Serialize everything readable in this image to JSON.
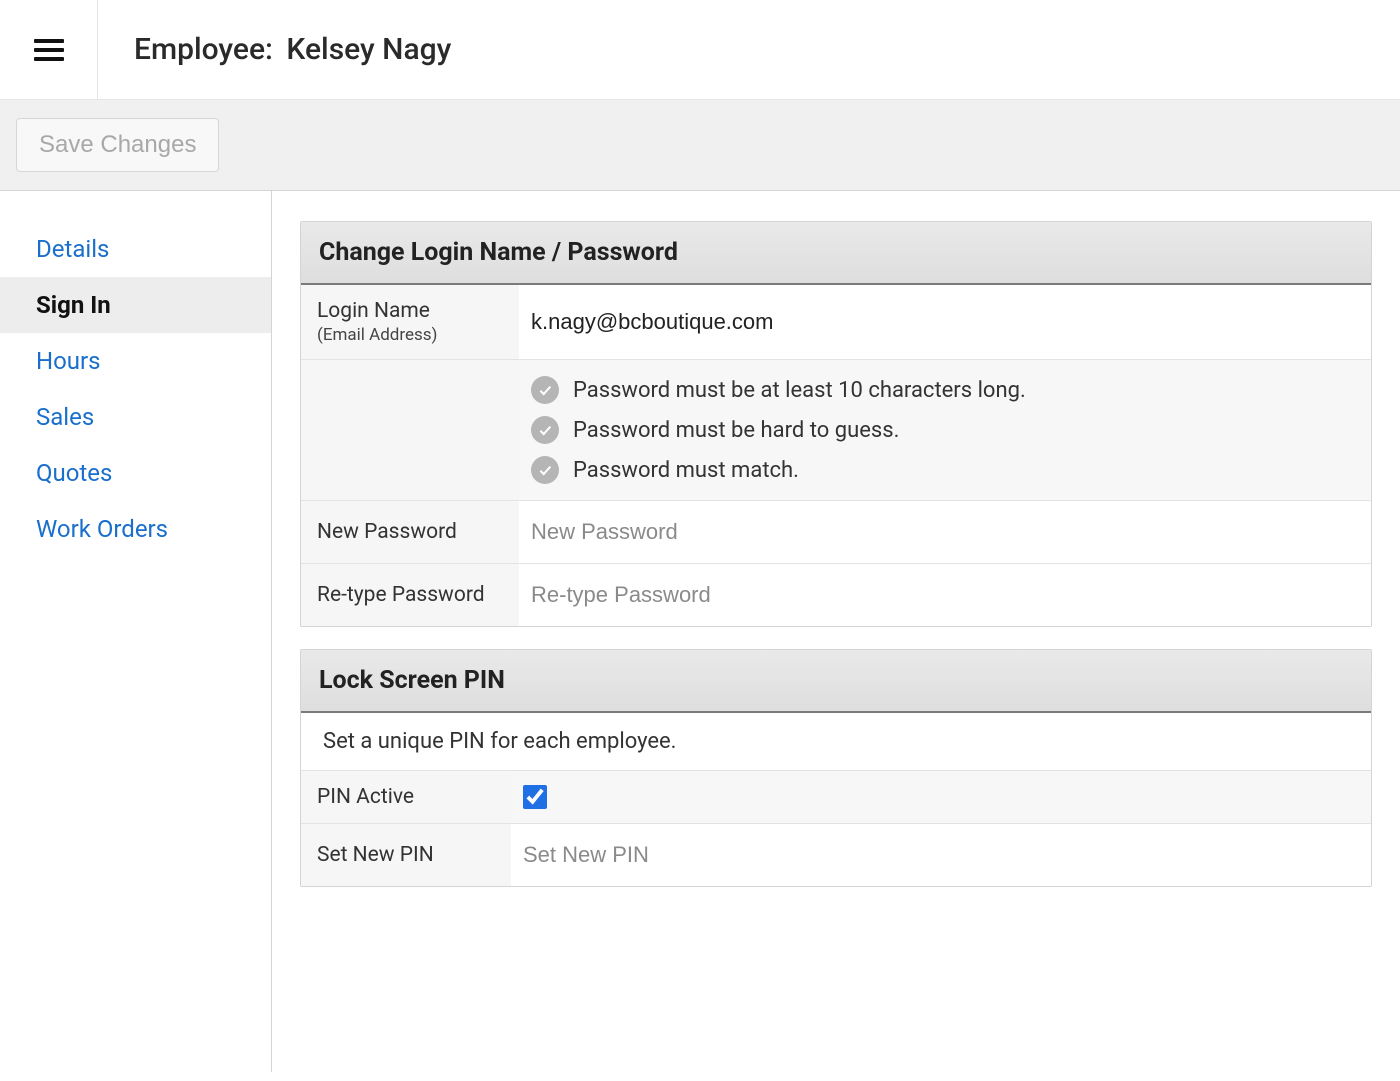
{
  "header": {
    "title_label": "Employee:",
    "employee_name": "Kelsey Nagy"
  },
  "toolbar": {
    "save_label": "Save Changes"
  },
  "sidebar": {
    "items": [
      {
        "label": "Details",
        "active": false
      },
      {
        "label": "Sign In",
        "active": true
      },
      {
        "label": "Hours",
        "active": false
      },
      {
        "label": "Sales",
        "active": false
      },
      {
        "label": "Quotes",
        "active": false
      },
      {
        "label": "Work Orders",
        "active": false
      }
    ]
  },
  "login_panel": {
    "header": "Change Login Name / Password",
    "login_name_label": "Login Name",
    "login_name_sublabel": "(Email Address)",
    "login_name_value": "k.nagy@bcboutique.com",
    "rules": [
      "Password must be at least 10 characters long.",
      "Password must be hard to guess.",
      "Password must match."
    ],
    "new_password_label": "New Password",
    "new_password_placeholder": "New Password",
    "retype_password_label": "Re-type Password",
    "retype_password_placeholder": "Re-type Password"
  },
  "pin_panel": {
    "header": "Lock Screen PIN",
    "description": "Set a unique PIN for each employee.",
    "pin_active_label": "PIN Active",
    "pin_active_checked": true,
    "set_pin_label": "Set New PIN",
    "set_pin_placeholder": "Set New PIN"
  }
}
